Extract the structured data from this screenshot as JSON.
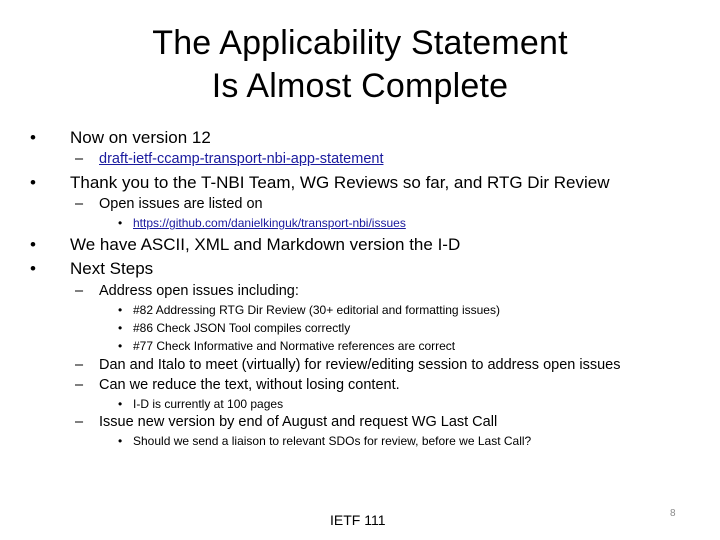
{
  "slide": {
    "title_line1": "The Applicability Statement",
    "title_line2": "Is Almost Complete",
    "bullet_glyph": "•",
    "dash_glyph": "–",
    "items": [
      {
        "level": 1,
        "text": "Now on version 12"
      },
      {
        "level": 2,
        "text": "draft-ietf-ccamp-transport-nbi-app-statement",
        "link": true
      },
      {
        "level": 1,
        "text": "Thank you to the T-NBI Team, WG Reviews so far, and RTG Dir Review"
      },
      {
        "level": 2,
        "text": "Open issues are listed on"
      },
      {
        "level": 3,
        "text": "https://github.com/danielkinguk/transport-nbi/issues",
        "link": true
      },
      {
        "level": 1,
        "text": "We have ASCII, XML and Markdown version the I-D"
      },
      {
        "level": 1,
        "text": "Next Steps"
      },
      {
        "level": 2,
        "text": "Address open issues including:"
      },
      {
        "level": 3,
        "text": "#82 Addressing RTG Dir Review (30+ editorial and formatting issues)"
      },
      {
        "level": 3,
        "text": "#86 Check JSON Tool compiles correctly"
      },
      {
        "level": 3,
        "text": "#77 Check Informative and Normative references are correct"
      },
      {
        "level": 2,
        "text": "Dan and Italo to meet (virtually) for review/editing session to address open issues"
      },
      {
        "level": 2,
        "text": "Can we reduce the text, without losing content."
      },
      {
        "level": 3,
        "text": "I-D is currently at 100 pages"
      },
      {
        "level": 2,
        "text": "Issue new version by end of August and request WG Last Call"
      },
      {
        "level": 3,
        "text": "Should we send a liaison to relevant SDOs for review, before we Last Call?"
      }
    ],
    "footer": "IETF 111",
    "page_number": "8"
  },
  "colors": {
    "text": "#000000",
    "link": "#1a1a9e",
    "page_number": "#8a8a8a"
  }
}
